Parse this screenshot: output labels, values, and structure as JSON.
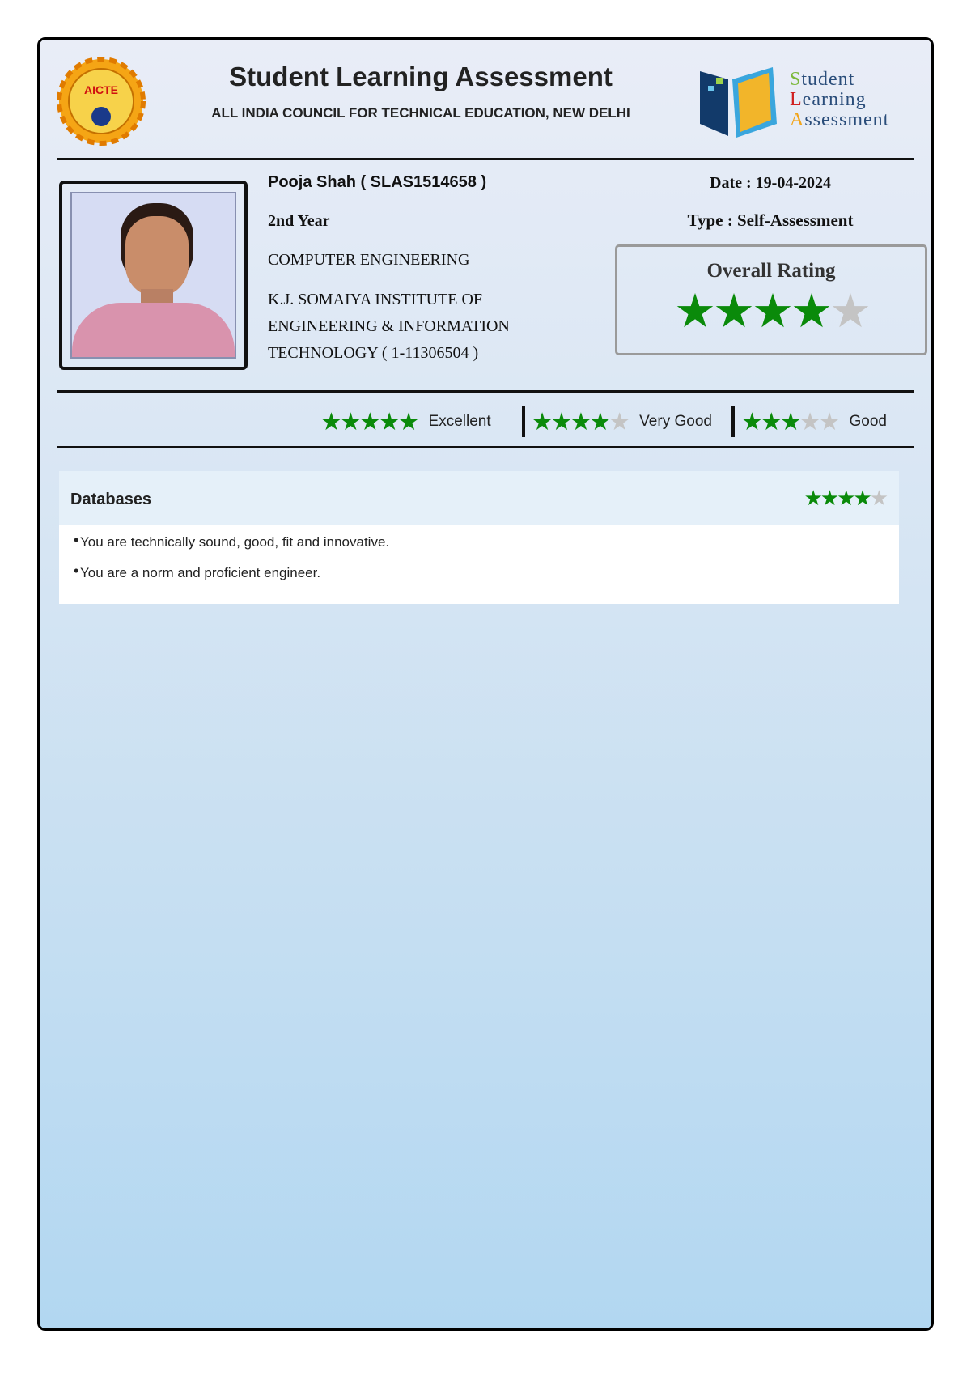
{
  "header": {
    "title": "Student Learning Assessment",
    "subtitle": "ALL INDIA COUNCIL FOR TECHNICAL EDUCATION, NEW DELHI",
    "left_logo_text": "AICTE",
    "right_logo_lines": [
      "Student",
      "Learning",
      "Assessment"
    ]
  },
  "student": {
    "name_id": "Pooja Shah ( SLAS1514658 )",
    "year": "2nd Year",
    "branch": "COMPUTER ENGINEERING",
    "institute_lines": [
      "K.J. SOMAIYA INSTITUTE OF",
      "ENGINEERING & INFORMATION",
      "TECHNOLOGY ( 1-11306504 )"
    ]
  },
  "meta": {
    "date": "Date : 19-04-2024",
    "type": "Type : Self-Assessment"
  },
  "overall": {
    "label": "Overall Rating",
    "rating": 4,
    "max": 5
  },
  "legend": [
    {
      "label": "Excellent",
      "rating": 5
    },
    {
      "label": "Very Good",
      "rating": 4
    },
    {
      "label": "Good",
      "rating": 3
    }
  ],
  "colors": {
    "star_on": "#0a8a0a",
    "star_off": "#c4c4c4"
  },
  "sections": [
    {
      "title": "Databases",
      "rating": 4,
      "max": 5,
      "points": [
        "You are technically sound, good, fit and innovative.",
        "You are a norm and proficient engineer."
      ]
    }
  ]
}
